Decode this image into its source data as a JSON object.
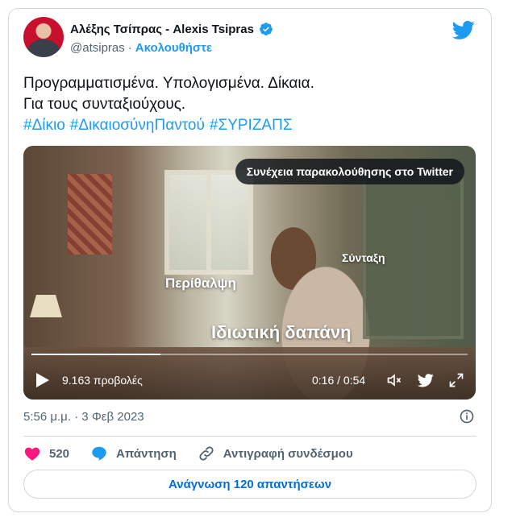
{
  "author": {
    "display_name": "Αλέξης Τσίπρας - Alexis Tsipras",
    "handle": "@atsipras",
    "separator": "·",
    "follow_label": "Ακολουθήστε",
    "verified": true
  },
  "tweet": {
    "line1": "Προγραμματισμένα. Υπολογισμένα. Δίκαια.",
    "line2": "Για τους συνταξιούχους.",
    "hashtags": [
      "#Δίκιο",
      "#ΔικαιοσύνηΠαντού",
      "#ΣΥΡΙΖΑΠΣ"
    ]
  },
  "video": {
    "continue_label": "Συνέχεια παρακολούθησης στο Twitter",
    "overlay_labels": [
      "Περίθαλψη",
      "Σύνταξη",
      "Ιδιωτική δαπάνη"
    ],
    "views": "9.163 προβολές",
    "time": "0:16 / 0:54",
    "progress": 0.296
  },
  "meta": {
    "timestamp": "5:56 μ.μ. · 3 Φεβ 2023"
  },
  "actions": {
    "likes": "520",
    "reply_label": "Απάντηση",
    "copy_link_label": "Αντιγραφή συνδέσμου"
  },
  "read_replies_label": "Ανάγνωση 120 απαντήσεων",
  "colors": {
    "accent": "#1d9bf0",
    "like": "#f91880",
    "muted": "#536471",
    "border": "#cfd9de"
  }
}
